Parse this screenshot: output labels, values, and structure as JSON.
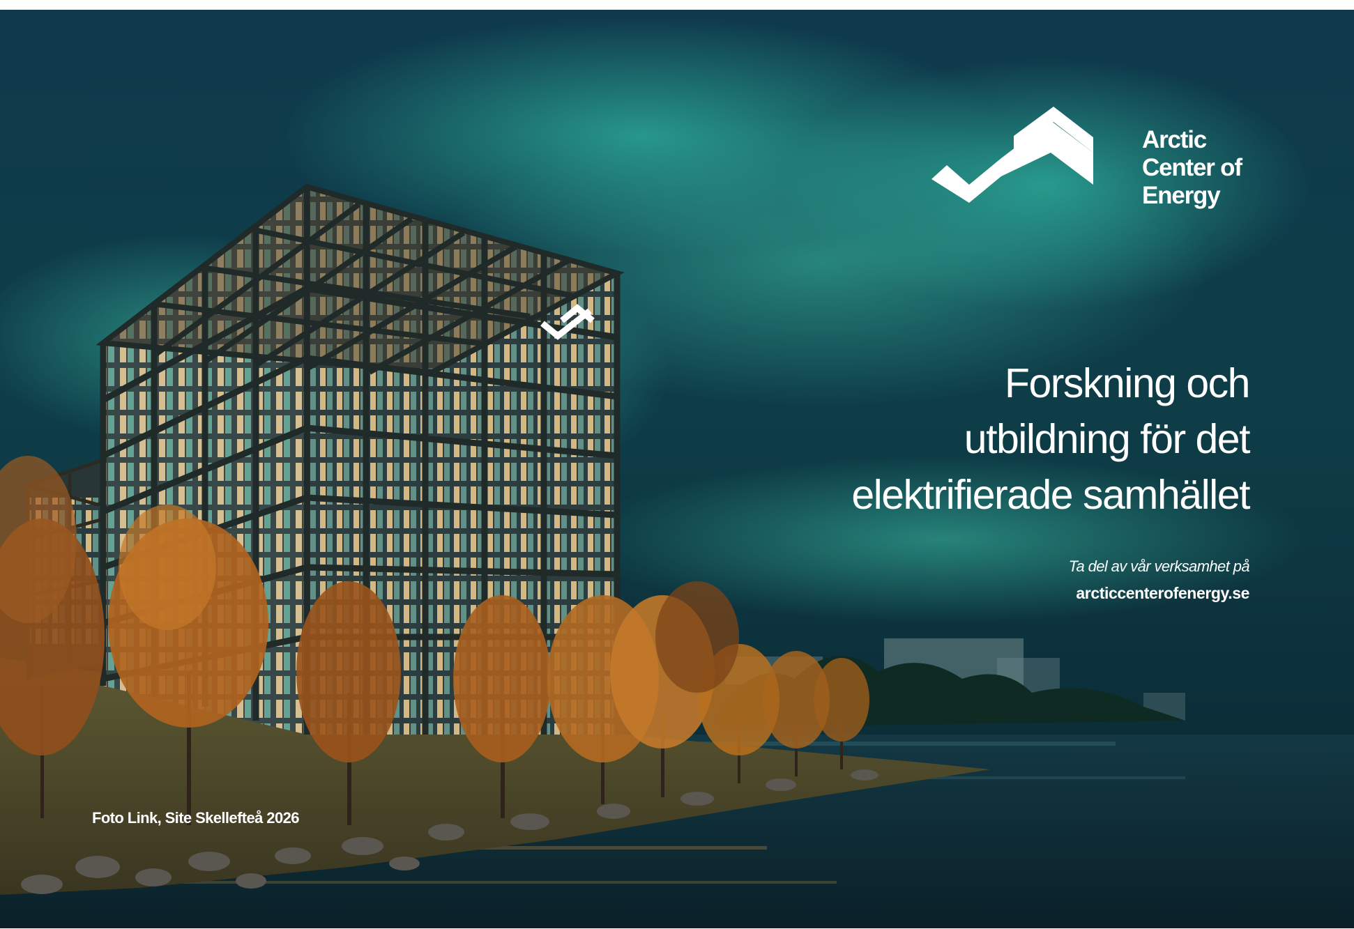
{
  "brand": {
    "name_lines": [
      "Arctic",
      "Center of",
      "Energy"
    ]
  },
  "headline": {
    "lines": [
      "Forskning och",
      "utbildning för det",
      "elektrifierade samhället"
    ]
  },
  "cta": {
    "intro": "Ta del av vår verksamhet på",
    "url": "arcticcenterofenergy.se"
  },
  "photo_credit": "Foto Link, Site Skellefteå 2026",
  "colors": {
    "sky_dark": "#0f3646",
    "aurora": "#27a897",
    "water": "#0e2a34",
    "window_glow": "#f2d7a4",
    "foliage": "#b86a22",
    "text": "#ffffff"
  },
  "icons": {
    "logo": "zigzag-chevron-logo-icon",
    "building_sign": "building-sign-logo-icon"
  }
}
